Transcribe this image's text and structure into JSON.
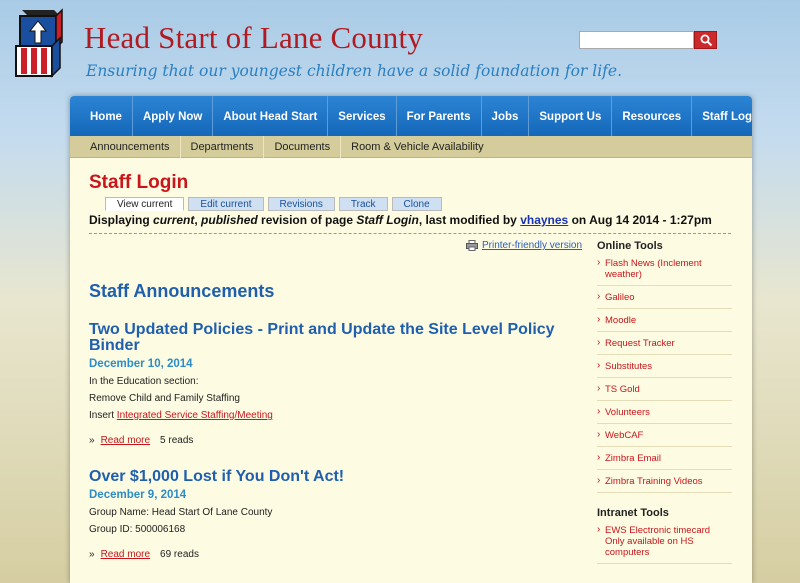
{
  "header": {
    "site_title": "Head Start of Lane County",
    "tagline": "Ensuring that our youngest children have a solid foundation for life.",
    "search_placeholder": ""
  },
  "main_nav": [
    "Home",
    "Apply Now",
    "About Head Start",
    "Services",
    "For Parents",
    "Jobs",
    "Support Us",
    "Resources",
    "Staff Login"
  ],
  "sub_nav": [
    "Announcements",
    "Departments",
    "Documents",
    "Room & Vehicle Availability"
  ],
  "page": {
    "title": "Staff Login",
    "tabs": [
      "View current",
      "Edit current",
      "Revisions",
      "Track",
      "Clone"
    ],
    "active_tab": "View current",
    "revision": {
      "prefix": "Displaying ",
      "current": "current",
      "sep1": ", ",
      "published": "published",
      "mid": " revision of page ",
      "page": "Staff Login",
      "modified": ", last modified by ",
      "user": "vhaynes",
      "on": " on Aug 14 2014 - 1:27pm"
    },
    "printer_link": "Printer-friendly version"
  },
  "announcements": {
    "heading": "Staff Announcements",
    "posts": [
      {
        "title": "Two Updated Policies - Print and Update the Site Level Policy Binder",
        "date": "December 10, 2014",
        "line1": "In the Education section:",
        "line2": "Remove Child and Family Staffing",
        "line3_prefix": "Insert ",
        "line3_link": "Integrated Service Staffing/Meeting",
        "bullet": "»",
        "read_more": "Read more",
        "reads": "5 reads"
      },
      {
        "title": "Over $1,000 Lost if You Don't Act!",
        "date": "December 9, 2014",
        "line1": "Group Name: Head Start Of Lane County",
        "line2": "Group ID: 500006168",
        "bullet": "»",
        "read_more": "Read more",
        "reads": "69 reads"
      }
    ]
  },
  "sidebar": {
    "online_heading": "Online Tools",
    "online_items": [
      "Flash News (Inclement weather)",
      "Galileo",
      "Moodle",
      "Request Tracker",
      "Substitutes",
      "TS Gold",
      "Volunteers",
      "WebCAF",
      "Zimbra Email",
      "Zimbra Training Videos"
    ],
    "intranet_heading": "Intranet Tools",
    "intranet_items": [
      "EWS Electronic timecard Only available on HS computers"
    ]
  },
  "colors": {
    "brand_red": "#b01b22",
    "nav_blue": "#1467b9",
    "link_blue": "#1f5fae",
    "panel_bg": "#fdfbe2"
  }
}
